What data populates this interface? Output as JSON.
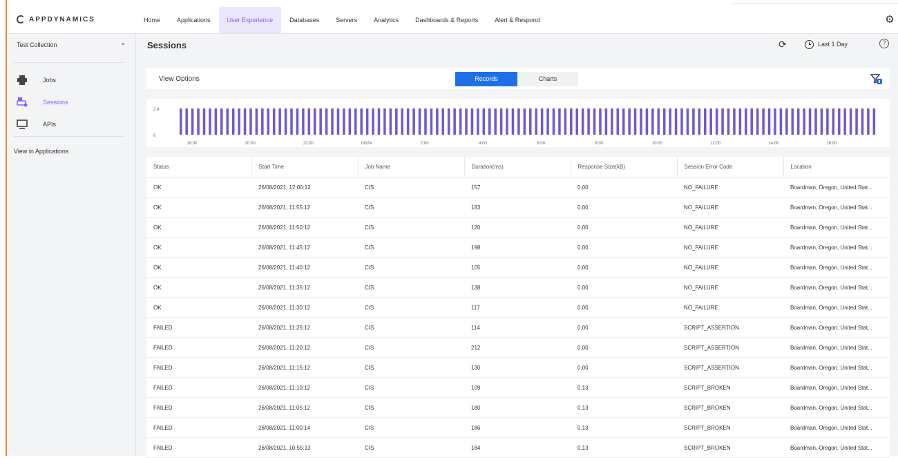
{
  "brand": {
    "logo_text": "APPDYNAMICS"
  },
  "nav": {
    "items": [
      "Home",
      "Applications",
      "User Experience",
      "Databases",
      "Servers",
      "Analytics",
      "Dashboards & Reports",
      "Alert & Respond"
    ],
    "active": "User Experience"
  },
  "sidebar": {
    "collection_label": "Test Collection",
    "items": [
      {
        "label": "Jobs",
        "icon": "jobs-icon"
      },
      {
        "label": "Sessions",
        "icon": "sessions-icon",
        "active": true
      },
      {
        "label": "APIs",
        "icon": "monitor-icon"
      }
    ],
    "link": "View in Applications"
  },
  "header": {
    "title": "Sessions",
    "time_range": "Last 1 Day"
  },
  "view_options": {
    "label": "View Options",
    "tabs": [
      "Records",
      "Charts"
    ],
    "active_tab": "Records"
  },
  "chart_data": {
    "type": "bar",
    "y_ticks": [
      "2.4",
      "0"
    ],
    "x_ticks": [
      "18:00",
      "20:00",
      "22:00",
      "08/24",
      "2:00",
      "4:00",
      "6:00",
      "8:00",
      "10:00",
      "12:00",
      "14:00",
      "16:00"
    ],
    "bar_value": 2.4,
    "bar_count": 120,
    "bar_color": "#6d5bd0"
  },
  "table": {
    "columns": [
      "Status",
      "Start Time",
      "Job Name",
      "Duration(ms)",
      "Response Size(kB)",
      "Session Error Code",
      "Location"
    ],
    "rows": [
      [
        "OK",
        "26/08/2021, 12:00:12",
        "CIS",
        "157",
        "0.00",
        "NO_FAILURE",
        "Boardman, Oregon, United Stat..."
      ],
      [
        "OK",
        "26/08/2021, 11:55:12",
        "CIS",
        "183",
        "0.00",
        "NO_FAILURE",
        "Boardman, Oregon, United Stat..."
      ],
      [
        "OK",
        "26/08/2021, 11:50:12",
        "CIS",
        "120",
        "0.00",
        "NO_FAILURE",
        "Boardman, Oregon, United Stat..."
      ],
      [
        "OK",
        "26/08/2021, 11:45:12",
        "CIS",
        "198",
        "0.00",
        "NO_FAILURE",
        "Boardman, Oregon, United Stat..."
      ],
      [
        "OK",
        "26/08/2021, 11:40:12",
        "CIS",
        "105",
        "0.00",
        "NO_FAILURE",
        "Boardman, Oregon, United Stat..."
      ],
      [
        "OK",
        "26/08/2021, 11:35:12",
        "CIS",
        "138",
        "0.00",
        "NO_FAILURE",
        "Boardman, Oregon, United Stat..."
      ],
      [
        "OK",
        "26/08/2021, 11:30:12",
        "CIS",
        "117",
        "0.00",
        "NO_FAILURE",
        "Boardman, Oregon, United Stat..."
      ],
      [
        "FAILED",
        "26/08/2021, 11:25:12",
        "CIS",
        "114",
        "0.00",
        "SCRIPT_ASSERTION",
        "Boardman, Oregon, United Stat..."
      ],
      [
        "FAILED",
        "26/08/2021, 11:20:12",
        "CIS",
        "212",
        "0.00",
        "SCRIPT_ASSERTION",
        "Boardman, Oregon, United Stat..."
      ],
      [
        "FAILED",
        "26/08/2021, 11:15:12",
        "CIS",
        "130",
        "0.00",
        "SCRIPT_ASSERTION",
        "Boardman, Oregon, United Stat..."
      ],
      [
        "FAILED",
        "26/08/2021, 11:10:12",
        "CIS",
        "109",
        "0.13",
        "SCRIPT_BROKEN",
        "Boardman, Oregon, United Stat..."
      ],
      [
        "FAILED",
        "26/08/2021, 11:05:12",
        "CIS",
        "180",
        "0.13",
        "SCRIPT_BROKEN",
        "Boardman, Oregon, United Stat..."
      ],
      [
        "FAILED",
        "26/08/2021, 11:00:14",
        "CIS",
        "186",
        "0.13",
        "SCRIPT_BROKEN",
        "Boardman, Oregon, United Stat..."
      ],
      [
        "FAILED",
        "26/08/2021, 10:55:13",
        "CIS",
        "184",
        "0.13",
        "SCRIPT_BROKEN",
        "Boardman, Oregon, United Stat..."
      ]
    ]
  },
  "colors": {
    "accent": "#7b61ff",
    "primary_button": "#1f6fe8",
    "page_background": "#f3f4f6"
  }
}
